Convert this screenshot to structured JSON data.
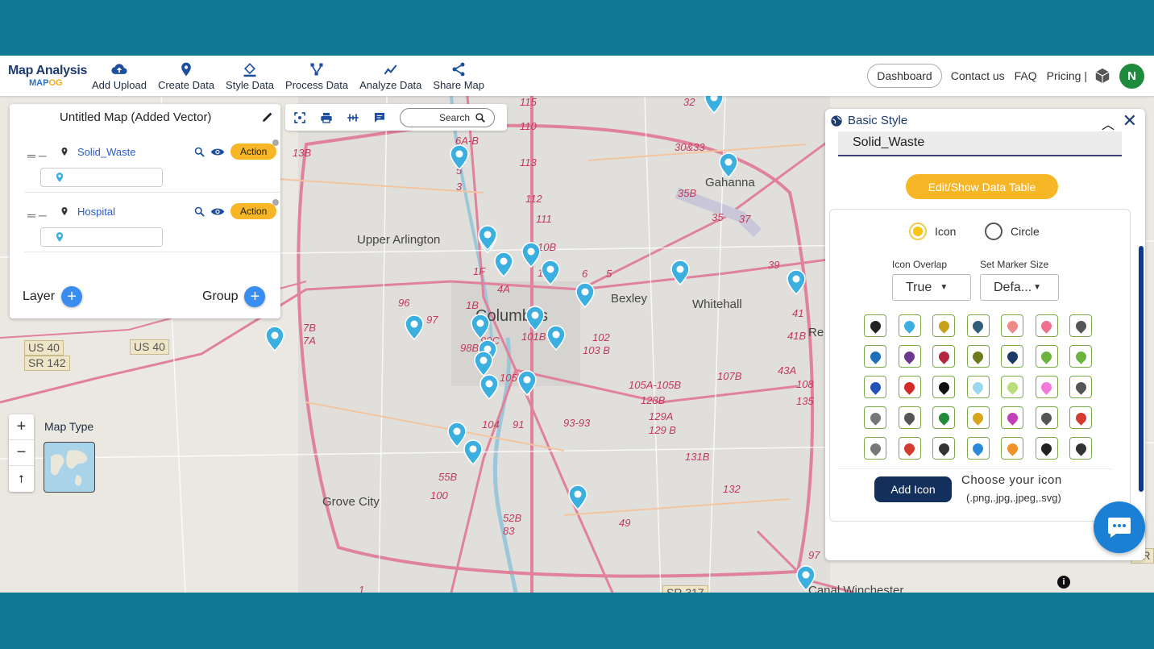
{
  "logo": {
    "line1": "Map Analysis",
    "line2a": "MAP",
    "line2b": "OG"
  },
  "nav": {
    "items": [
      {
        "label": "Add Upload",
        "icon": "cloud-upload-icon"
      },
      {
        "label": "Create Data",
        "icon": "location-pin-icon"
      },
      {
        "label": "Style Data",
        "icon": "paint-bucket-icon"
      },
      {
        "label": "Process Data",
        "icon": "process-icon"
      },
      {
        "label": "Analyze Data",
        "icon": "analyze-icon"
      },
      {
        "label": "Share Map",
        "icon": "share-icon"
      }
    ],
    "dashboard": "Dashboard",
    "contact": "Contact us",
    "faq": "FAQ",
    "pricing": "Pricing |",
    "avatar": "N"
  },
  "layers": {
    "title": "Untitled Map (Added Vector)",
    "items": [
      {
        "name": "Solid_Waste",
        "action": "Action"
      },
      {
        "name": "Hospital",
        "action": "Action"
      }
    ],
    "layer_label": "Layer",
    "group_label": "Group"
  },
  "toolbar": {
    "search": "Search"
  },
  "map": {
    "maptype_label": "Map Type",
    "places": {
      "upper_arlington": "Upper Arlington",
      "columbus": "Columbus",
      "bexley": "Bexley",
      "whitehall": "Whitehall",
      "gahanna": "Gahanna",
      "grove_city": "Grove City",
      "reynoldsburg": "Re",
      "canal_winchester": "Canal Winchester"
    },
    "shields": {
      "us40a": "US 40",
      "sr142": "SR 142",
      "us40b": "US 40",
      "sr": "SR",
      "sr317": "SR 317"
    },
    "routes": [
      "6A-B",
      "5",
      "3",
      "115",
      "110",
      "113",
      "112",
      "111",
      "10B",
      "10A",
      "1F",
      "4A",
      "1B",
      "6",
      "5",
      "97",
      "96",
      "7B",
      "7A",
      "99C",
      "98B",
      "101B",
      "102",
      "103 B",
      "105",
      "104",
      "91",
      "93-93",
      "105A-105B",
      "107B",
      "128B",
      "129A",
      "129 B",
      "131B",
      "132",
      "55B",
      "100",
      "52B",
      "83",
      "49",
      "13B",
      "32",
      "30&33",
      "35B",
      "35",
      "37",
      "39",
      "41",
      "41B",
      "43A",
      "108",
      "135",
      "97",
      "1"
    ]
  },
  "style": {
    "title": "Basic Style",
    "layer_value": "Solid_Waste",
    "edit_btn": "Edit/Show Data Table",
    "radio_icon": "Icon",
    "radio_circle": "Circle",
    "overlap_label": "Icon Overlap",
    "overlap_value": "True",
    "size_label": "Set Marker Size",
    "size_value": "Defa...",
    "add_icon": "Add Icon",
    "choose": "Choose your icon",
    "exts": "(.png,.jpg,.jpeg,.svg)"
  },
  "colors": {
    "brand": "#117896",
    "accent": "#f7b626",
    "pin": "#3bb0e0",
    "road": "#e0829c"
  }
}
